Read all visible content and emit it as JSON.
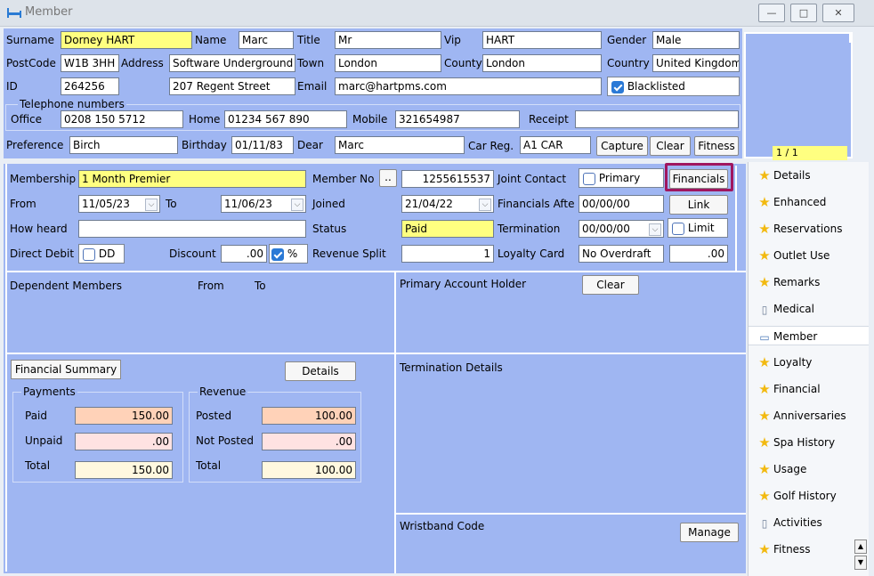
{
  "window": {
    "title": "Member",
    "btn_min": "—",
    "btn_max": "□",
    "btn_close": "✕"
  },
  "top": {
    "surname_label": "Surname",
    "surname": "Dorney HART",
    "name_label": "Name",
    "name": "Marc",
    "title_label": "Title",
    "title": "Mr",
    "vip_label": "Vip",
    "vip": "HART",
    "gender_label": "Gender",
    "gender": "Male",
    "postcode_label": "PostCode",
    "postcode": "W1B 3HH",
    "address_label": "Address",
    "address1": "Software Underground",
    "address2": "207 Regent Street",
    "town_label": "Town",
    "town": "London",
    "county_label": "County",
    "county": "London",
    "country_label": "Country",
    "country": "United Kingdom",
    "id_label": "ID",
    "id": "264256",
    "email_label": "Email",
    "email": "marc@hartpms.com",
    "blacklisted_label": "Blacklisted",
    "telephone_label": "Telephone numbers",
    "office_label": "Office",
    "office": "0208 150 5712",
    "home_label": "Home",
    "home": "01234 567 890",
    "mobile_label": "Mobile",
    "mobile": "321654987",
    "receipt_label": "Receipt",
    "receipt": "",
    "preference_label": "Preference",
    "preference": "Birch",
    "birthday_label": "Birthday",
    "birthday": "01/11/83",
    "dear_label": "Dear",
    "dear": "Marc",
    "carreg_label": "Car Reg.",
    "carreg": "A1 CAR",
    "capture_btn": "Capture",
    "clear_btn": "Clear",
    "fitness_btn": "Fitness",
    "photo_counter": "1 / 1"
  },
  "membership": {
    "membership_label": "Membership",
    "membership": "1 Month Premier",
    "memberno_label": "Member No",
    "memberno_btn": "..",
    "memberno": "1255615537",
    "joint_label": "Joint Contact",
    "primary_label": "Primary",
    "financials_btn": "Financials",
    "from_label": "From",
    "from": "11/05/23",
    "to_label": "To",
    "to": "11/06/23",
    "joined_label": "Joined",
    "joined": "21/04/22",
    "finafter_label": "Financials Afte",
    "finafter": "00/00/00",
    "link_btn": "Link",
    "howheard_label": "How heard",
    "howheard": "",
    "status_label": "Status",
    "status": "Paid",
    "termination_label": "Termination",
    "termination": "00/00/00",
    "limit_label": "Limit",
    "dd_label": "Direct Debit",
    "dd_chk": "DD",
    "discount_label": "Discount",
    "discount": ".00",
    "pct": "%",
    "revsplit_label": "Revenue Split",
    "revsplit": "1",
    "loyalty_label": "Loyalty Card",
    "loyalty": "No Overdraft",
    "loyalty_val": ".00"
  },
  "dependents": {
    "title": "Dependent Members",
    "from": "From",
    "to": "To"
  },
  "primary": {
    "title": "Primary Account Holder",
    "clear": "Clear"
  },
  "financial": {
    "summary_btn": "Financial Summary",
    "details_btn": "Details",
    "payments_label": "Payments",
    "revenue_label": "Revenue",
    "paid_label": "Paid",
    "paid": "150.00",
    "unpaid_label": "Unpaid",
    "unpaid": ".00",
    "ptotal_label": "Total",
    "ptotal": "150.00",
    "posted_label": "Posted",
    "posted": "100.00",
    "notposted_label": "Not Posted",
    "notposted": ".00",
    "rtotal_label": "Total",
    "rtotal": "100.00"
  },
  "termination": {
    "title": "Termination Details"
  },
  "wristband": {
    "title": "Wristband Code",
    "manage": "Manage"
  },
  "sidebar": {
    "items": [
      {
        "label": "Details",
        "icon": "star-icon"
      },
      {
        "label": "Enhanced",
        "icon": "star-icon"
      },
      {
        "label": "Reservations",
        "icon": "star-icon"
      },
      {
        "label": "Outlet Use",
        "icon": "star-icon"
      },
      {
        "label": "Remarks",
        "icon": "star-icon"
      },
      {
        "label": "Medical",
        "icon": "document-icon"
      },
      {
        "label": "Member",
        "icon": "monitor-icon"
      },
      {
        "label": "Loyalty",
        "icon": "star-icon"
      },
      {
        "label": "Financial",
        "icon": "star-icon"
      },
      {
        "label": "Anniversaries",
        "icon": "star-icon"
      },
      {
        "label": "Spa History",
        "icon": "star-icon"
      },
      {
        "label": "Usage",
        "icon": "star-icon"
      },
      {
        "label": "Golf History",
        "icon": "star-icon"
      },
      {
        "label": "Activities",
        "icon": "document-icon"
      },
      {
        "label": "Fitness",
        "icon": "star-icon"
      }
    ]
  }
}
